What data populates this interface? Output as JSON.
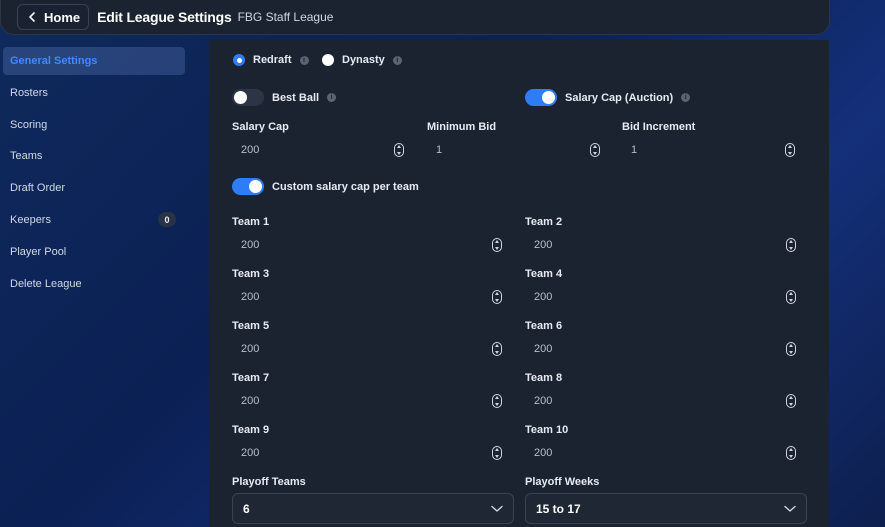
{
  "header": {
    "home_label": "Home",
    "title": "Edit League Settings",
    "league_name": "FBG Staff League"
  },
  "sidebar": {
    "items": [
      {
        "label": "General Settings",
        "active": true
      },
      {
        "label": "Rosters"
      },
      {
        "label": "Scoring"
      },
      {
        "label": "Teams"
      },
      {
        "label": "Draft Order"
      },
      {
        "label": "Keepers",
        "badge": "0"
      },
      {
        "label": "Player Pool"
      },
      {
        "label": "Delete League"
      }
    ]
  },
  "league_type": {
    "options": [
      "Redraft",
      "Dynasty"
    ],
    "selected": "Redraft"
  },
  "toggles": {
    "best_ball": {
      "label": "Best Ball",
      "on": false
    },
    "salary_cap": {
      "label": "Salary Cap (Auction)",
      "on": true
    },
    "custom_cap": {
      "label": "Custom salary cap per team",
      "on": true
    }
  },
  "auction": {
    "salary_cap": {
      "label": "Salary Cap",
      "value": "200"
    },
    "minimum_bid": {
      "label": "Minimum Bid",
      "value": "1"
    },
    "bid_increment": {
      "label": "Bid Increment",
      "value": "1"
    }
  },
  "teams": [
    {
      "label": "Team 1",
      "value": "200"
    },
    {
      "label": "Team 2",
      "value": "200"
    },
    {
      "label": "Team 3",
      "value": "200"
    },
    {
      "label": "Team 4",
      "value": "200"
    },
    {
      "label": "Team 5",
      "value": "200"
    },
    {
      "label": "Team 6",
      "value": "200"
    },
    {
      "label": "Team 7",
      "value": "200"
    },
    {
      "label": "Team 8",
      "value": "200"
    },
    {
      "label": "Team 9",
      "value": "200"
    },
    {
      "label": "Team 10",
      "value": "200"
    }
  ],
  "playoffs": {
    "teams": {
      "label": "Playoff Teams",
      "value": "6"
    },
    "weeks": {
      "label": "Playoff Weeks",
      "value": "15 to 17"
    }
  },
  "colors": {
    "accent": "#2f7df6",
    "panel": "#1c2330"
  }
}
